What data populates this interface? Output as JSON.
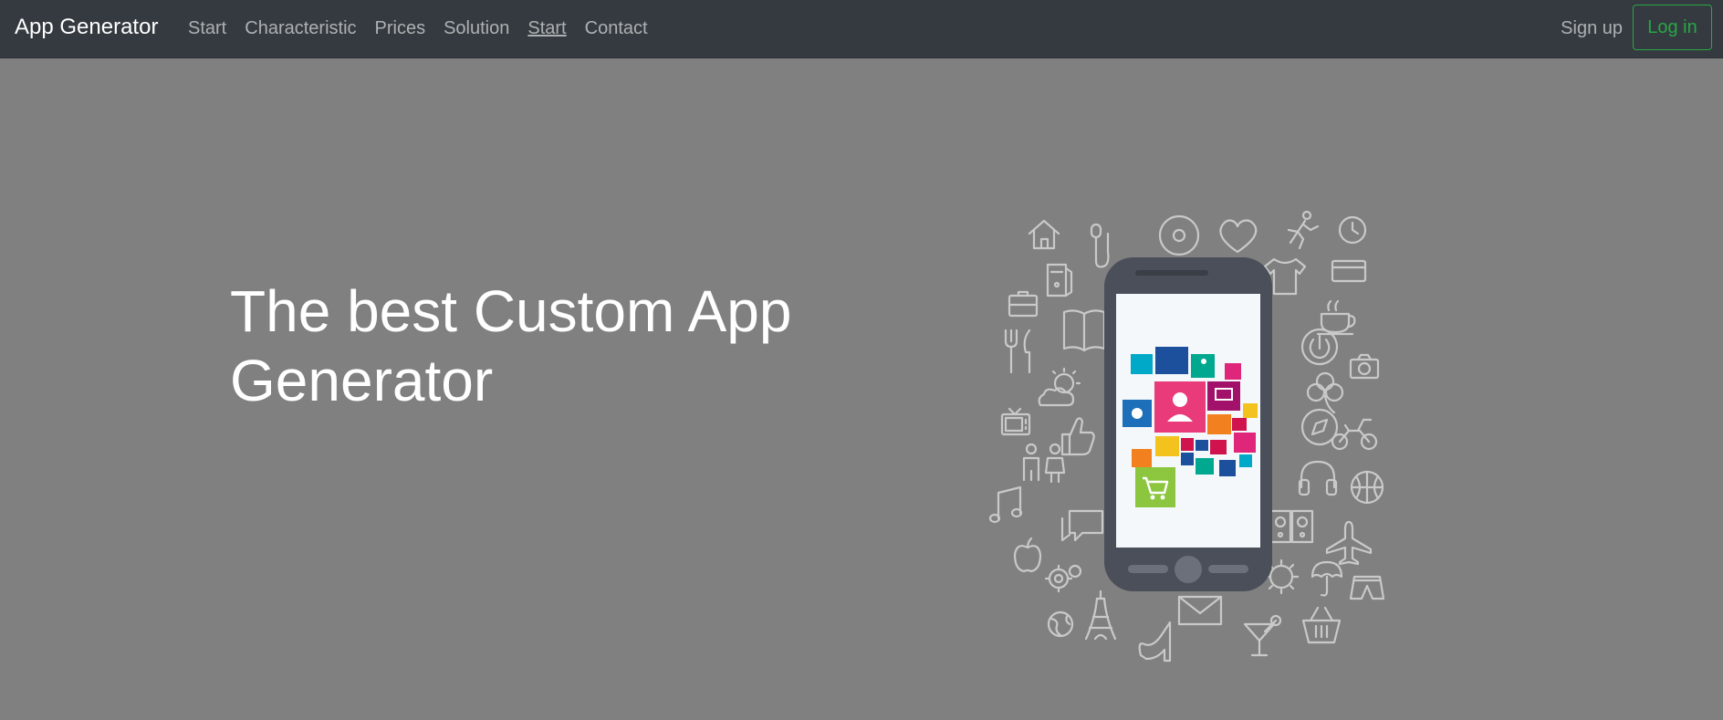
{
  "nav": {
    "brand": "App Generator",
    "links": [
      {
        "label": "Start"
      },
      {
        "label": "Characteristic"
      },
      {
        "label": "Prices"
      },
      {
        "label": "Solution"
      },
      {
        "label": "Start"
      },
      {
        "label": "Contact"
      }
    ],
    "signup_label": "Sign up",
    "login_label": "Log in"
  },
  "hero": {
    "title": "The best Custom App Generator"
  },
  "colors": {
    "navbar_bg": "#343a40",
    "hero_bg": "#808080",
    "login_accent": "#28a745",
    "phone_body": "#4a4f59",
    "phone_screen": "#f4f8fb"
  },
  "illustration_icons": [
    "home-icon",
    "microphone-icon",
    "disc-icon",
    "heart-icon",
    "runner-icon",
    "clock-icon",
    "computer-tower-icon",
    "tshirt-icon",
    "credit-card-icon",
    "briefcase-icon",
    "book-icon",
    "coffee-cup-icon",
    "fork-knife-icon",
    "power-icon",
    "camera-icon",
    "weather-icon",
    "clover-icon",
    "tv-icon",
    "thumbs-up-icon",
    "compass-icon",
    "motorcycle-icon",
    "family-icon",
    "headphones-icon",
    "basketball-icon",
    "music-note-icon",
    "chat-icon",
    "speakers-icon",
    "airplane-icon",
    "apple-icon",
    "gears-icon",
    "sun-icon",
    "umbrella-icon",
    "shorts-icon",
    "globe-icon",
    "eiffel-tower-icon",
    "envelope-icon",
    "high-heel-icon",
    "cocktail-icon",
    "basket-icon",
    "smartphone-icon",
    "app-tiles-icon"
  ]
}
